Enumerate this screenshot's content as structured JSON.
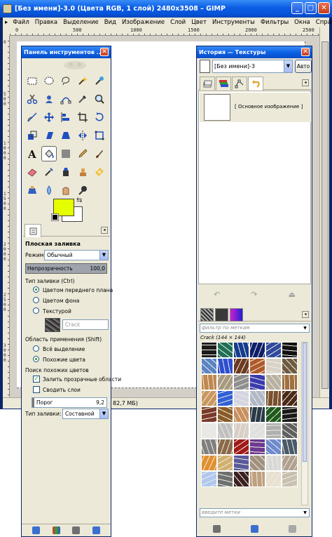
{
  "main_window": {
    "title": "[Без имени]-3.0 (Цвета RGB, 1 слой) 2480x3508 – GIMP",
    "menu": [
      "Файл",
      "Правка",
      "Выделение",
      "Вид",
      "Изображение",
      "Слой",
      "Цвет",
      "Инструменты",
      "Фильтры",
      "Окна",
      "Справка"
    ],
    "menu_arrow": "▸",
    "status_memory": "82,7 МБ)",
    "ruler_top_marks": [
      "0",
      "500",
      "1000",
      "1500",
      "2000",
      "2500"
    ],
    "ruler_left_marks": [
      "0",
      "500",
      "1000",
      "1500",
      "2000",
      "2500",
      "3000"
    ]
  },
  "toolbox": {
    "title": "Панель инструментов ...",
    "tools": [
      "rect-select-icon",
      "ellipse-select-icon",
      "lasso-icon",
      "fuzzy-select-icon",
      "select-by-color-icon",
      "scissors-icon",
      "foreground-select-icon",
      "paths-icon",
      "color-picker-icon",
      "zoom-icon",
      "measure-icon",
      "move-icon",
      "align-icon",
      "crop-icon",
      "rotate-icon",
      "scale-icon",
      "shear-icon",
      "perspective-icon",
      "flip-icon",
      "cage-icon",
      "text-icon",
      "bucket-fill-icon",
      "blend-icon",
      "pencil-icon",
      "paintbrush-icon",
      "eraser-icon",
      "airbrush-icon",
      "ink-icon",
      "clone-icon",
      "heal-icon",
      "perspective-clone-icon",
      "blur-icon",
      "smudge-icon",
      "dodge-burn-icon"
    ],
    "colors": {
      "fg": "#e6ff00",
      "bg": "#ffffff"
    },
    "tool_options": {
      "title": "Плоская заливка",
      "mode_label": "Режим:",
      "mode_value": "Обычный",
      "opacity_label": "Непрозрачность",
      "opacity_value": "100,0",
      "fill_type_label": "Тип заливки  (Ctrl)",
      "fill_type_options": [
        "Цветом переднего плана",
        "Цветом фона",
        "Текстурой"
      ],
      "pattern_name": "Crack",
      "area_label": "Область применения  (Shift)",
      "area_options": [
        "Всё выделение",
        "Похожие цвета"
      ],
      "similar_label": "Поиск похожих цветов",
      "transparent_label": "Залить прозрачные области",
      "merge_label": "Сводить слои",
      "threshold_label": "Порог",
      "threshold_value": "9,2",
      "fill_by_label": "Тип заливки:",
      "fill_by_value": "Составной"
    }
  },
  "dock": {
    "title": "История — Текстуры",
    "image_select": "[Без имени]-3",
    "auto_button": "Авто",
    "history_item": "[ Основное изображение ]",
    "pattern_filter_placeholder": "фильтр по меткам",
    "pattern_name": "Crack  (144 × 144)",
    "tags_placeholder": "введите метки",
    "patterns": [
      "#1c1c1c",
      "#1f6e55",
      "#153d8f",
      "#0f1f6a",
      "#2f4a9e",
      "#111111",
      "#5a84c4",
      "#2e4fd0",
      "#6b3a22",
      "#b05a2a",
      "#d8d2c8",
      "#6d5a40",
      "#c08850",
      "#a89a80",
      "#8e8e8e",
      "#3b3bb0",
      "#b8b0a0",
      "#a07040",
      "#c9975f",
      "#3060d8",
      "#d4d4e4",
      "#b0b8c8",
      "#7a5030",
      "#4a2a18",
      "#7a3a2a",
      "#8a5a2a",
      "#c89060",
      "#2a3a4a",
      "#1e5a1e",
      "#1a1a1a",
      "#e8e8e8",
      "#c0c0c0",
      "#d8d0c8",
      "#e0e0e0",
      "#b0b0b0",
      "#606060",
      "#808080",
      "#8a6a4a",
      "#a01818",
      "#6c3a90",
      "#6e8ad0",
      "#4a5a6a",
      "#e09030",
      "#d0b070",
      "#5a5a9a",
      "#a09080",
      "#d8d8d8",
      "#b0a090",
      "#b0c8f0",
      "#6e7070",
      "#3a2020",
      "#c0a080",
      "#e8e0d0",
      "#c8c0b0"
    ]
  }
}
